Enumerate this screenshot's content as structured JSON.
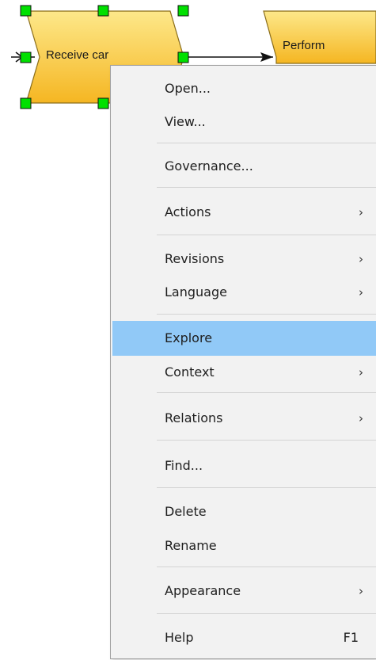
{
  "diagram": {
    "shape_receive_label": "Receive car",
    "shape_perform_label": "Perform"
  },
  "colors": {
    "shape_fill_top": "#fde88a",
    "shape_fill_bottom": "#f5b622",
    "shape_stroke": "#8a6d1a",
    "handle_fill": "#00e000",
    "menu_bg": "#f2f2f2",
    "highlight": "#91c9f7"
  },
  "context_menu": {
    "items": [
      {
        "label": "Open...",
        "arrow": "",
        "shortcut": ""
      },
      {
        "label": "View...",
        "arrow": "",
        "shortcut": ""
      },
      {
        "label": "Governance...",
        "arrow": "",
        "shortcut": ""
      },
      {
        "label": "Actions",
        "arrow": "›",
        "shortcut": ""
      },
      {
        "label": "Revisions",
        "arrow": "›",
        "shortcut": ""
      },
      {
        "label": "Language",
        "arrow": "›",
        "shortcut": ""
      },
      {
        "label": "Explore",
        "arrow": "",
        "shortcut": "",
        "highlighted": true
      },
      {
        "label": "Context",
        "arrow": "›",
        "shortcut": ""
      },
      {
        "label": "Relations",
        "arrow": "›",
        "shortcut": ""
      },
      {
        "label": "Find...",
        "arrow": "",
        "shortcut": ""
      },
      {
        "label": "Delete",
        "arrow": "",
        "shortcut": ""
      },
      {
        "label": "Rename",
        "arrow": "",
        "shortcut": ""
      },
      {
        "label": "Appearance",
        "arrow": "›",
        "shortcut": ""
      },
      {
        "label": "Help",
        "arrow": "",
        "shortcut": "F1"
      }
    ]
  }
}
